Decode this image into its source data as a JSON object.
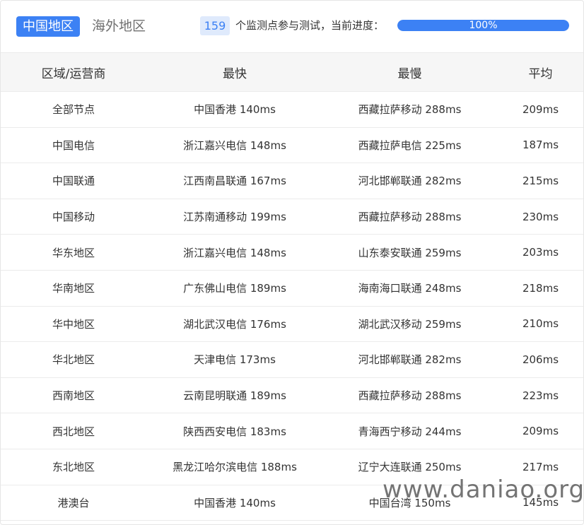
{
  "tabs": {
    "active": "中国地区",
    "inactive": "海外地区"
  },
  "summary": {
    "count": "159",
    "text": "个监测点参与测试，当前进度：",
    "progress_label": "100%",
    "progress_fraction": 1.0
  },
  "table": {
    "headers": [
      "区域/运营商",
      "最快",
      "最慢",
      "平均"
    ],
    "rows": [
      [
        "全部节点",
        "中国香港 140ms",
        "西藏拉萨移动 288ms",
        "209ms"
      ],
      [
        "中国电信",
        "浙江嘉兴电信 148ms",
        "西藏拉萨电信 225ms",
        "187ms"
      ],
      [
        "中国联通",
        "江西南昌联通 167ms",
        "河北邯郸联通 282ms",
        "215ms"
      ],
      [
        "中国移动",
        "江苏南通移动 199ms",
        "西藏拉萨移动 288ms",
        "230ms"
      ],
      [
        "华东地区",
        "浙江嘉兴电信 148ms",
        "山东泰安联通 259ms",
        "203ms"
      ],
      [
        "华南地区",
        "广东佛山电信 189ms",
        "海南海口联通 248ms",
        "218ms"
      ],
      [
        "华中地区",
        "湖北武汉电信 176ms",
        "湖北武汉移动 259ms",
        "210ms"
      ],
      [
        "华北地区",
        "天津电信 173ms",
        "河北邯郸联通 282ms",
        "206ms"
      ],
      [
        "西南地区",
        "云南昆明联通 189ms",
        "西藏拉萨移动 288ms",
        "223ms"
      ],
      [
        "西北地区",
        "陕西西安电信 183ms",
        "青海西宁移动 244ms",
        "209ms"
      ],
      [
        "东北地区",
        "黑龙江哈尔滨电信 188ms",
        "辽宁大连联通 250ms",
        "217ms"
      ],
      [
        "港澳台",
        "中国香港 140ms",
        "中国台湾 150ms",
        "145ms"
      ]
    ]
  },
  "watermark": "www.daniao.org",
  "colors": {
    "accent": "#3c81f4",
    "badge_bg": "#dfeafc",
    "header_bg": "#f6f6f6"
  }
}
